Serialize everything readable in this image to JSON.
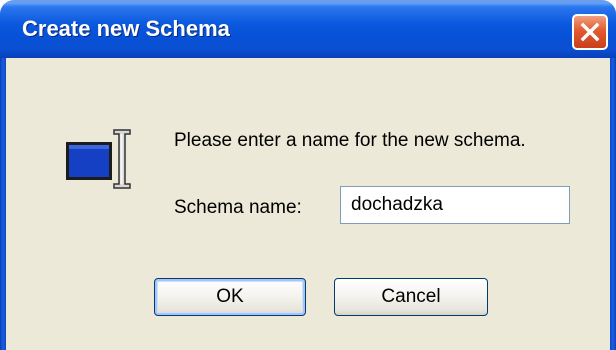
{
  "window": {
    "title": "Create new Schema",
    "close_label": "Close"
  },
  "dialog": {
    "icon": "text-field-cursor-icon",
    "prompt": "Please enter a name for the new schema.",
    "field_label": "Schema name:",
    "field_value": "dochadzka",
    "ok_label": "OK",
    "cancel_label": "Cancel"
  },
  "colors": {
    "titlebar": "#0b59de",
    "client_background": "#ece9d8",
    "close_button": "#e25a2e",
    "input_border": "#7f9db9",
    "button_border": "#003c74"
  }
}
